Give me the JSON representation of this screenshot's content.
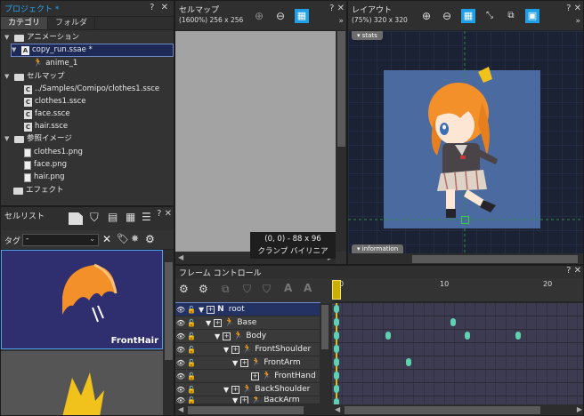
{
  "project": {
    "title": "プロジェクト *",
    "tabs": [
      "カテゴリ",
      "フォルダ"
    ],
    "tree": [
      {
        "label": "アニメーション",
        "type": "folder"
      },
      {
        "label": "copy_run.ssae *",
        "type": "anim",
        "selected": true
      },
      {
        "label": "anime_1",
        "type": "run"
      },
      {
        "label": "セルマップ",
        "type": "folder"
      },
      {
        "label": "../Samples/Comipo/clothes1.ssce",
        "type": "c"
      },
      {
        "label": "clothes1.ssce",
        "type": "c"
      },
      {
        "label": "face.ssce",
        "type": "c"
      },
      {
        "label": "hair.ssce",
        "type": "c"
      },
      {
        "label": "参照イメージ",
        "type": "folder"
      },
      {
        "label": "clothes1.png",
        "type": "file"
      },
      {
        "label": "face.png",
        "type": "file"
      },
      {
        "label": "hair.png",
        "type": "file"
      },
      {
        "label": "エフェクト",
        "type": "folder"
      }
    ]
  },
  "cellmap": {
    "title": "セルマップ",
    "info": "(1600%) 256 x 256",
    "coords": "(0, 0) - 88 x 96",
    "filter": "クランプ バイリニア"
  },
  "layout": {
    "title": "レイアウト",
    "info": "(75%) 320 x 320",
    "stats_label": "stats",
    "information_label": "information"
  },
  "cell_list": {
    "title": "セルリスト",
    "tag_label": "タグ",
    "tag_value": "-",
    "preview_label": "FrontHair"
  },
  "frame_control": {
    "title": "フレーム コントロール",
    "ruler": [
      "0",
      "10",
      "20"
    ],
    "rows": [
      {
        "label": "root",
        "prefix": "N",
        "indent": 0,
        "selected": true
      },
      {
        "label": "Base",
        "indent": 1
      },
      {
        "label": "Body",
        "indent": 2
      },
      {
        "label": "FrontShoulder",
        "indent": 3
      },
      {
        "label": "FrontArm",
        "indent": 4
      },
      {
        "label": "FrontHand",
        "indent": 5
      },
      {
        "label": "BackShoulder",
        "indent": 3
      },
      {
        "label": "BackArm",
        "indent": 4
      }
    ]
  },
  "colors": {
    "accent": "#1f9fe6",
    "canvas_bg": "#4a6aa0",
    "preview_bg": "#2f2e6e",
    "keyframe": "#5fd0b0"
  }
}
